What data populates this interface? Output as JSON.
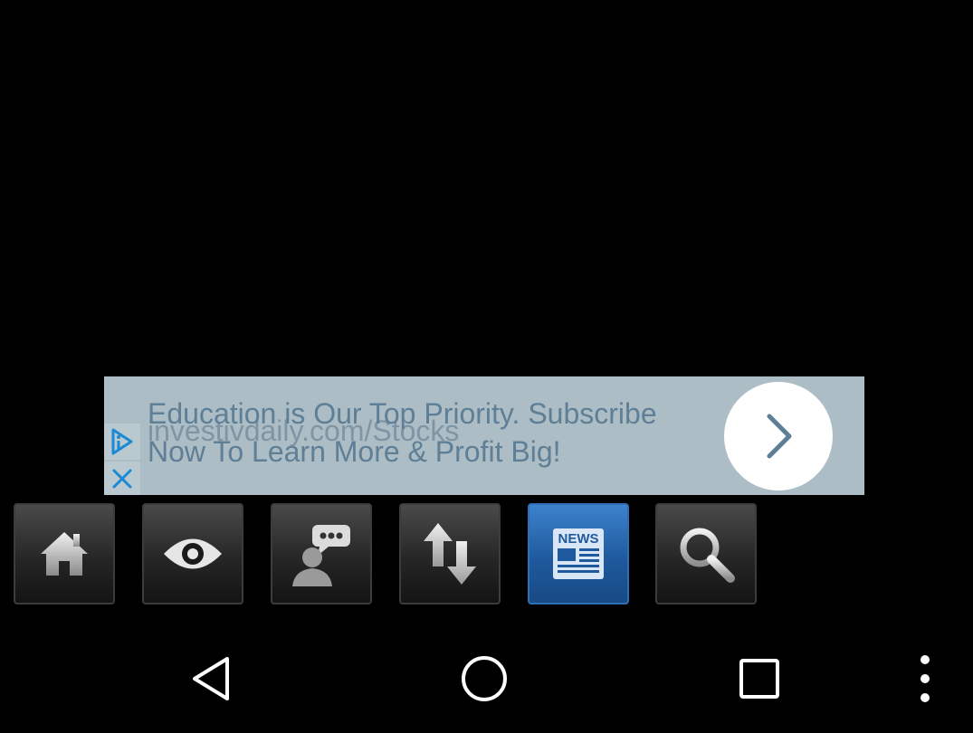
{
  "ad": {
    "headline": "Education is Our Top Priority. Subscribe Now To Learn More & Profit Big!",
    "url": "investivdaily.com/Stocks",
    "colors": {
      "background": "#adbdc6",
      "text": "#5e7f96",
      "accent": "#1a8ad4"
    }
  },
  "toolbar": {
    "active_index": 4,
    "items": [
      {
        "icon": "home-icon"
      },
      {
        "icon": "eye-icon"
      },
      {
        "icon": "chat-person-icon"
      },
      {
        "icon": "sort-arrows-icon"
      },
      {
        "icon": "newspaper-icon",
        "label": "NEWS"
      },
      {
        "icon": "search-icon"
      }
    ],
    "colors": {
      "active": "#2f6fb5",
      "inactive": "#262626"
    }
  },
  "navbar": {
    "items": [
      {
        "icon": "back-icon"
      },
      {
        "icon": "home-circle-icon"
      },
      {
        "icon": "recents-icon"
      },
      {
        "icon": "overflow-menu-icon"
      }
    ]
  }
}
